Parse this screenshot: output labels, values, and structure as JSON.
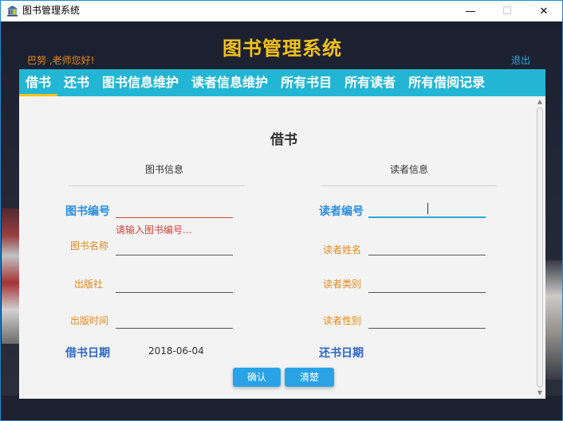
{
  "window": {
    "title": "图书管理系统",
    "icon": "library-icon"
  },
  "header": {
    "brand": "图书管理系统",
    "greeting": "巴努 ,老师您好!",
    "logout": "退出"
  },
  "nav": {
    "tabs": [
      {
        "label": "借书",
        "active": true
      },
      {
        "label": "还书"
      },
      {
        "label": "图书信息维护"
      },
      {
        "label": "读者信息维护"
      },
      {
        "label": "所有书目"
      },
      {
        "label": "所有读者"
      },
      {
        "label": "所有借阅记录"
      }
    ]
  },
  "form": {
    "title": "借书",
    "book_section": "图书信息",
    "reader_section": "读者信息",
    "book_id_label": "图书编号",
    "book_id_error": "请输入图书编号...",
    "book_name_label": "图书名称",
    "publisher_label": "出版社",
    "publish_date_label": "出版时间",
    "borrow_date_label": "借书日期",
    "borrow_date_value": "2018-06-04",
    "reader_id_label": "读者编号",
    "reader_name_label": "读者姓名",
    "reader_type_label": "读者类别",
    "reader_gender_label": "读者性别",
    "return_date_label": "还书日期",
    "confirm": "确认",
    "clear": "清楚"
  },
  "colors": {
    "brand": "#f4c21a",
    "nav_bg": "#23b6d4",
    "accent": "#29a8e0",
    "label_orange": "#e48a1c",
    "error": "#d0453c"
  }
}
